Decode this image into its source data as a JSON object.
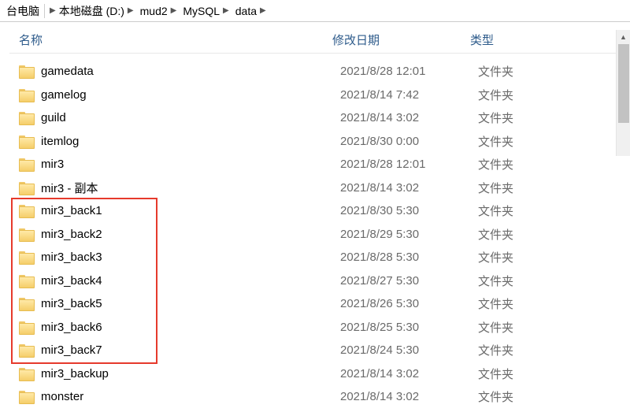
{
  "breadcrumb": {
    "items": [
      {
        "label": "台电脑"
      },
      {
        "label": "本地磁盘 (D:)"
      },
      {
        "label": "mud2"
      },
      {
        "label": "MySQL"
      },
      {
        "label": "data"
      }
    ]
  },
  "columns": {
    "name": "名称",
    "date": "修改日期",
    "type": "类型"
  },
  "rows": [
    {
      "name": "gamedata",
      "date": "2021/8/28 12:01",
      "type": "文件夹"
    },
    {
      "name": "gamelog",
      "date": "2021/8/14 7:42",
      "type": "文件夹"
    },
    {
      "name": "guild",
      "date": "2021/8/14 3:02",
      "type": "文件夹"
    },
    {
      "name": "itemlog",
      "date": "2021/8/30 0:00",
      "type": "文件夹"
    },
    {
      "name": "mir3",
      "date": "2021/8/28 12:01",
      "type": "文件夹"
    },
    {
      "name": "mir3 - 副本",
      "date": "2021/8/14 3:02",
      "type": "文件夹"
    },
    {
      "name": "mir3_back1",
      "date": "2021/8/30 5:30",
      "type": "文件夹"
    },
    {
      "name": "mir3_back2",
      "date": "2021/8/29 5:30",
      "type": "文件夹"
    },
    {
      "name": "mir3_back3",
      "date": "2021/8/28 5:30",
      "type": "文件夹"
    },
    {
      "name": "mir3_back4",
      "date": "2021/8/27 5:30",
      "type": "文件夹"
    },
    {
      "name": "mir3_back5",
      "date": "2021/8/26 5:30",
      "type": "文件夹"
    },
    {
      "name": "mir3_back6",
      "date": "2021/8/25 5:30",
      "type": "文件夹"
    },
    {
      "name": "mir3_back7",
      "date": "2021/8/24 5:30",
      "type": "文件夹"
    },
    {
      "name": "mir3_backup",
      "date": "2021/8/14 3:02",
      "type": "文件夹"
    },
    {
      "name": "monster",
      "date": "2021/8/14 3:02",
      "type": "文件夹"
    }
  ]
}
